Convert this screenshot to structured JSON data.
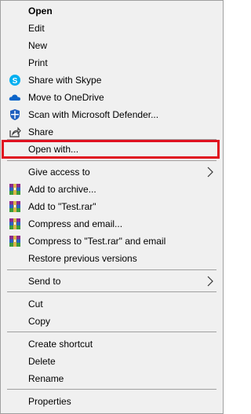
{
  "menu": {
    "items": [
      {
        "label": "Open",
        "icon": ""
      },
      {
        "label": "Edit",
        "icon": ""
      },
      {
        "label": "New",
        "icon": ""
      },
      {
        "label": "Print",
        "icon": ""
      },
      {
        "label": "Share with Skype",
        "icon": "skype-icon"
      },
      {
        "label": "Move to OneDrive",
        "icon": "onedrive-icon"
      },
      {
        "label": "Scan with Microsoft Defender...",
        "icon": "defender-icon"
      },
      {
        "label": "Share",
        "icon": "share-icon"
      },
      {
        "label": "Open with...",
        "icon": ""
      },
      {
        "label": "Give access to",
        "icon": "",
        "submenu": true
      },
      {
        "label": "Add to archive...",
        "icon": "winrar-icon"
      },
      {
        "label": "Add to \"Test.rar\"",
        "icon": "winrar-icon"
      },
      {
        "label": "Compress and email...",
        "icon": "winrar-icon"
      },
      {
        "label": "Compress to \"Test.rar\" and email",
        "icon": "winrar-icon"
      },
      {
        "label": "Restore previous versions",
        "icon": ""
      },
      {
        "label": "Send to",
        "icon": "",
        "submenu": true
      },
      {
        "label": "Cut",
        "icon": ""
      },
      {
        "label": "Copy",
        "icon": ""
      },
      {
        "label": "Create shortcut",
        "icon": ""
      },
      {
        "label": "Delete",
        "icon": ""
      },
      {
        "label": "Rename",
        "icon": ""
      },
      {
        "label": "Properties",
        "icon": ""
      }
    ]
  },
  "colors": {
    "highlight_border": "#e0101f",
    "menu_background": "#f0f0f0",
    "separator": "#a0a0a0"
  }
}
